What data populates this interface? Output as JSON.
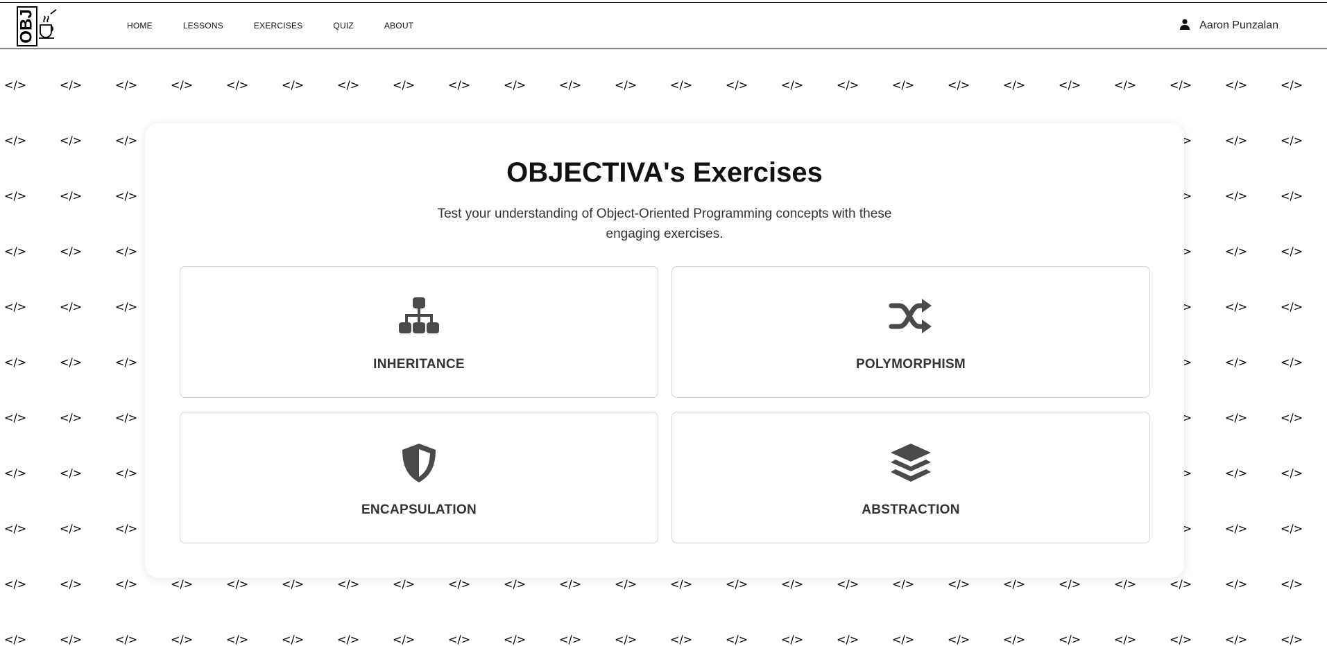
{
  "nav": {
    "logo_text": "OBJ",
    "links": [
      "HOME",
      "LESSONS",
      "EXERCISES",
      "QUIZ",
      "ABOUT"
    ],
    "user_icon": "user-icon",
    "user_name": "Aaron Punzalan"
  },
  "background": {
    "tag": "</>"
  },
  "main": {
    "title": "OBJECTIVA's Exercises",
    "subtitle": "Test your understanding of Object-Oriented Programming concepts with these engaging exercises.",
    "cards": [
      {
        "label": "INHERITANCE",
        "icon": "sitemap-icon"
      },
      {
        "label": "POLYMORPHISM",
        "icon": "shuffle-icon"
      },
      {
        "label": "ENCAPSULATION",
        "icon": "shield-icon"
      },
      {
        "label": "ABSTRACTION",
        "icon": "layers-icon"
      }
    ]
  },
  "colors": {
    "icon": "#4a4a4a",
    "text": "#333333",
    "border": "#d6d6d6"
  }
}
